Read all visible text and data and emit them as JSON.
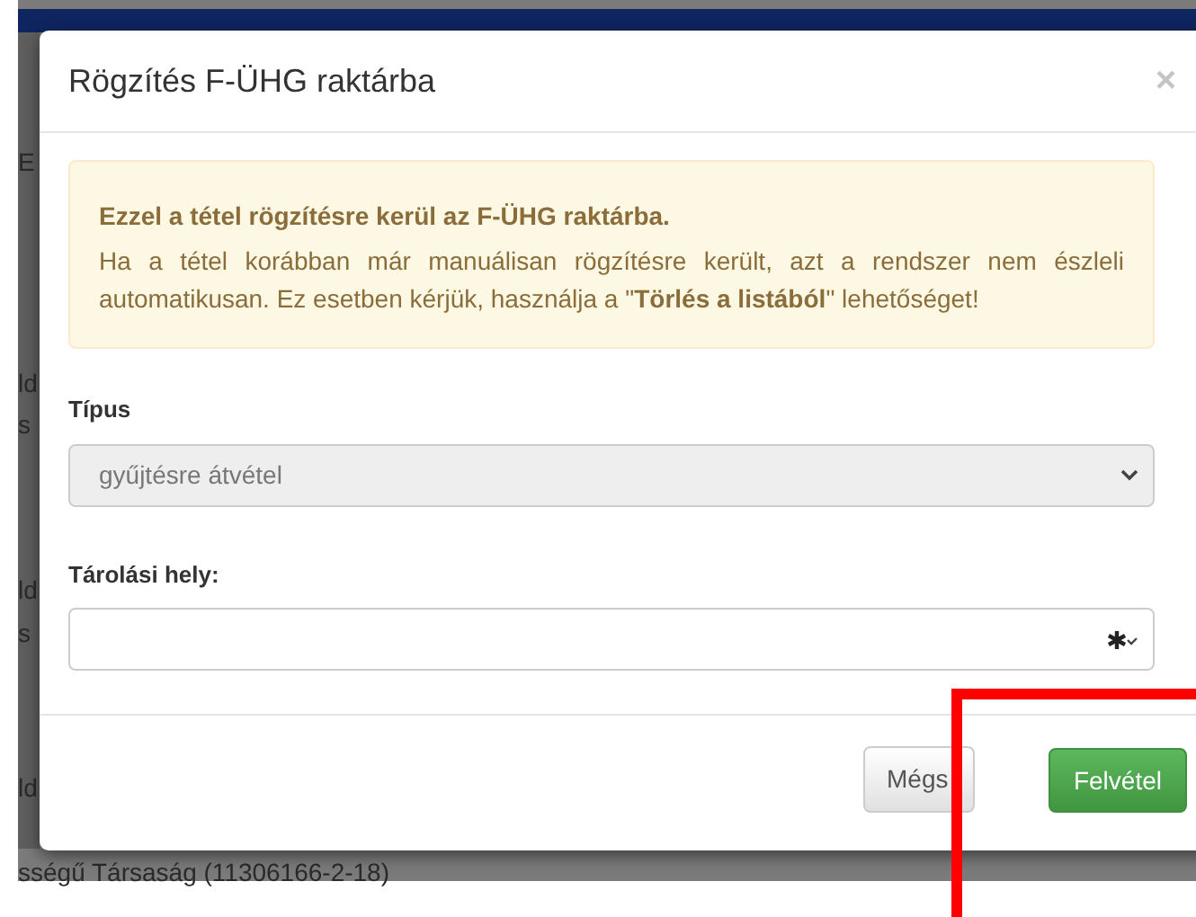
{
  "background_texts": [
    {
      "text": "E"
    },
    {
      "text": "ld"
    },
    {
      "text": "s"
    },
    {
      "text": "ld"
    },
    {
      "text": "s"
    },
    {
      "text": "ld"
    },
    {
      "text": "sségű Társaság (11306166-2-18)"
    }
  ],
  "modal": {
    "title": "Rögzítés F-ÜHG raktárba",
    "close": "×",
    "alert": {
      "heading": "Ezzel a tétel rögzítésre kerül az F-ÜHG raktárba.",
      "body": "Ha a tétel korábban már manuálisan rögzítésre került, azt a rendszer nem észleli automatikusan. Ez esetben kérjük, használja a \"**Törlés a listából**\" lehetőséget!"
    },
    "fields": [
      {
        "kind": "select",
        "label": "Típus",
        "value": "gyűjtésre átvétel",
        "disabled": true
      },
      {
        "kind": "combobox",
        "label": "Tárolási hely:",
        "disabled": false
      }
    ],
    "buttons": [
      {
        "label": "Mégs",
        "kind": "default"
      },
      {
        "label": "Felvétel",
        "kind": "primary"
      }
    ]
  },
  "annotation": {
    "kind": "highlight-frame"
  }
}
